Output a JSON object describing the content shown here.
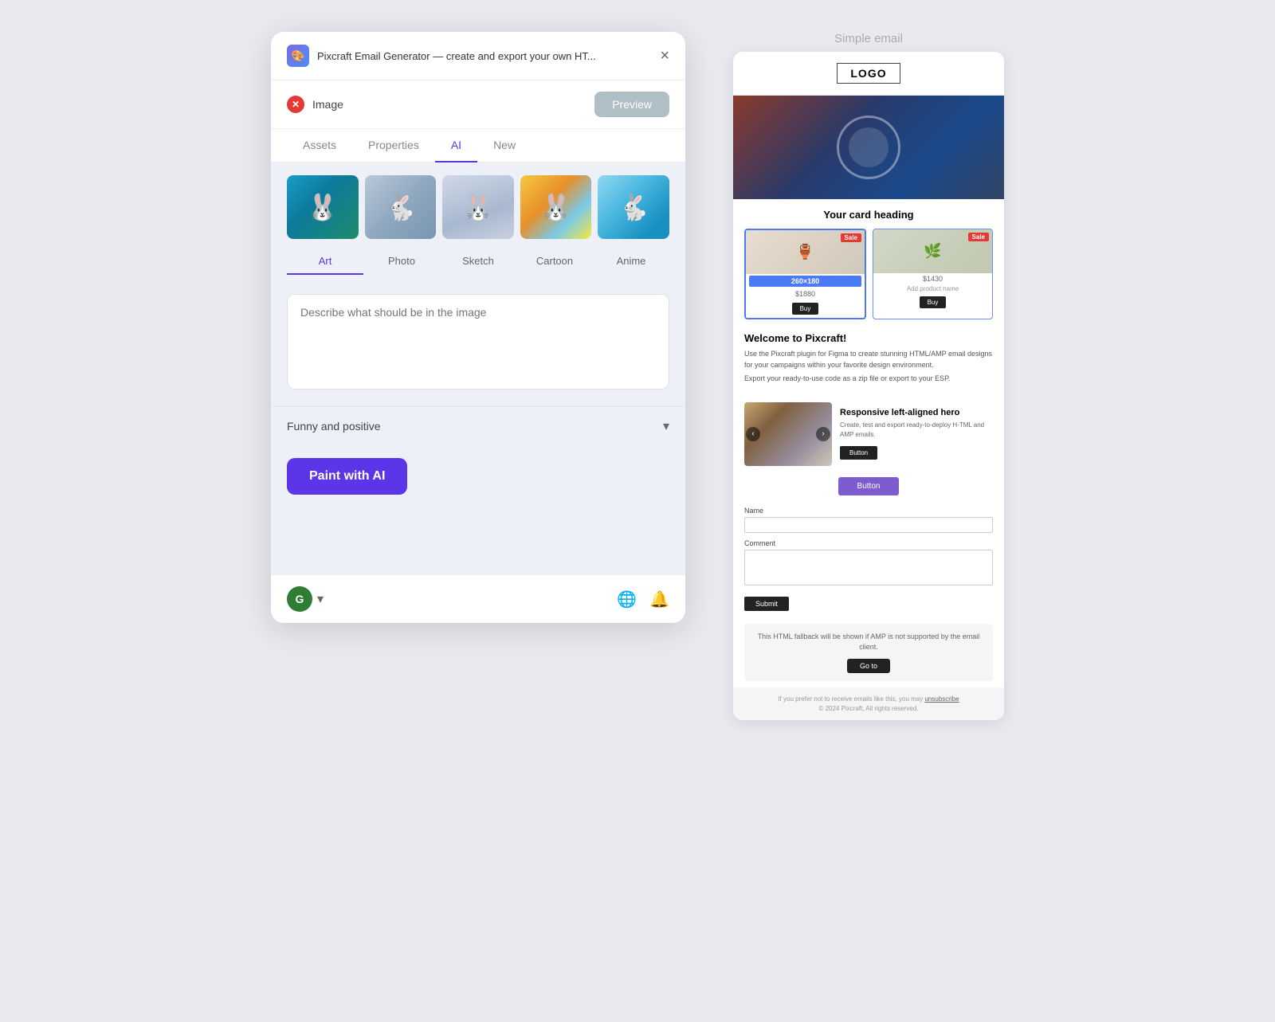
{
  "panel": {
    "title": "Pixcraft Email Generator — create and export your own HT...",
    "icon_label": "P",
    "close_label": "×",
    "image_label": "Image",
    "preview_btn": "Preview",
    "tabs": [
      "Assets",
      "Properties",
      "AI",
      "New"
    ],
    "active_tab": "AI",
    "style_tabs": [
      "Art",
      "Photo",
      "Sketch",
      "Cartoon",
      "Anime"
    ],
    "active_style": "Art",
    "prompt_placeholder": "Describe what should be in the image",
    "mood_label": "Funny and positive",
    "paint_btn": "Paint with AI",
    "user_initial": "G",
    "gallery_images": [
      {
        "label": "bunny-beach",
        "emoji": "🐰"
      },
      {
        "label": "bunny-float",
        "emoji": "🐇"
      },
      {
        "label": "bunny-sketch",
        "emoji": "🐰"
      },
      {
        "label": "bunny-cartoon",
        "emoji": "🐰"
      },
      {
        "label": "bunny-splash",
        "emoji": "🐇"
      }
    ]
  },
  "email": {
    "page_label": "Simple email",
    "logo": "LOGO",
    "card_heading": "Your card heading",
    "product1_price": "$1880",
    "product1_dimension": "260×180",
    "product2_price": "$1430",
    "product2_name": "Add product name",
    "sale_badge": "Sale",
    "buy_btn": "Buy",
    "welcome_title": "Welcome to Pixcraft!",
    "welcome_text1": "Use the Pixcraft plugin for Figma to create stunning HTML/AMP email designs for your campaigns within your favorite design environment.",
    "welcome_text2": "Export your ready-to-use code as a zip file or export to your ESP.",
    "hero_title": "Responsive left-aligned hero",
    "hero_desc": "Create, test and export ready-to-deploy H-TML and AMP emails.",
    "hero_btn": "Button",
    "cta_btn": "Button",
    "form_name_label": "Name",
    "form_comment_label": "Comment",
    "form_submit": "Submit",
    "amp_notice": "This HTML fallback will be shown if AMP is not supported by the email client.",
    "goto_btn": "Go to",
    "footer_text": "If you prefer not to receive emails like this, you may",
    "footer_link": "unsubscribe",
    "footer_copyright": "© 2024 Pixcraft, All rights reserved."
  }
}
